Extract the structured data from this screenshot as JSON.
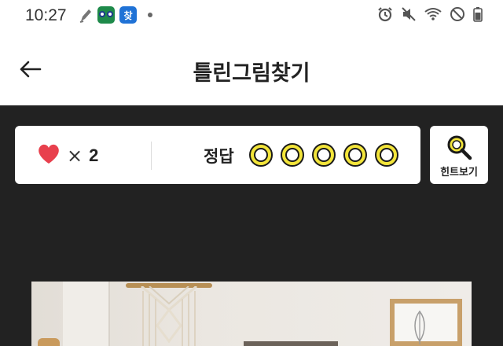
{
  "status_bar": {
    "time": "10:27",
    "app2_badge": "찾",
    "icons_left": [
      "pen-icon",
      "tripadvisor-app-icon",
      "app-badge-icon",
      "notification-dot-icon"
    ],
    "icons_right": [
      "alarm-icon",
      "mute-vibrate-icon",
      "wifi-icon",
      "do-not-disturb-icon",
      "battery-charging-icon"
    ]
  },
  "app_bar": {
    "back_icon": "arrow-left-icon",
    "title": "틀린그림찾기"
  },
  "score": {
    "heart_icon": "heart-icon",
    "times": "×",
    "lives": "2",
    "answer_label": "정답",
    "answers_total": 5,
    "answers_found": 0
  },
  "hint": {
    "icon": "magnifier-icon",
    "label": "힌트보기"
  },
  "colors": {
    "background": "#222222",
    "heart": "#e8404d",
    "slot_yellow": "#f3e53a",
    "card": "#ffffff"
  }
}
